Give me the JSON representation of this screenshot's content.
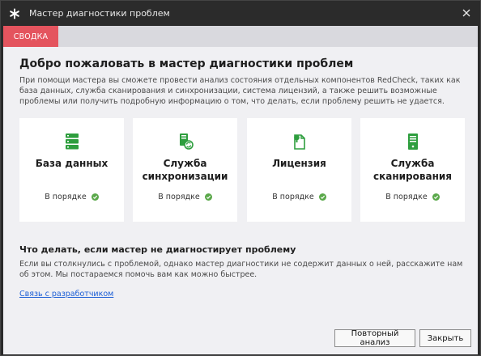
{
  "window": {
    "title": "Мастер диагностики проблем"
  },
  "tabs": [
    {
      "label": "СВОДКА",
      "active": true
    }
  ],
  "main": {
    "welcome_title": "Добро пожаловать в мастер диагностики проблем",
    "intro": "При помощи мастера вы сможете провести анализ состояния отдельных компонентов RedCheck, таких как база данных, служба сканирования и синхронизации, система лицензий, а также решить возможные проблемы или получить подробную информацию о том, что делать, если проблему решить не удается."
  },
  "cards": [
    {
      "title_line1": "База данных",
      "title_line2": "",
      "icon": "database-icon",
      "status": "В порядке"
    },
    {
      "title_line1": "Служба",
      "title_line2": "синхронизации",
      "icon": "sync-service-icon",
      "status": "В порядке"
    },
    {
      "title_line1": "Лицензия",
      "title_line2": "",
      "icon": "license-icon",
      "status": "В порядке"
    },
    {
      "title_line1": "Служба",
      "title_line2": "сканирования",
      "icon": "server-icon",
      "status": "В порядке"
    }
  ],
  "help": {
    "title": "Что делать, если мастер не диагностирует проблему",
    "text": "Если вы столкнулись с проблемой, однако мастер диагностики не содержит данных о ней, расскажите нам об этом. Мы постараемся помочь вам как можно быстрее.",
    "link": "Связь с разработчиком"
  },
  "footer": {
    "reanalyze_label": "Повторный анализ",
    "close_label": "Закрыть"
  },
  "colors": {
    "accent_tab": "#e4545e",
    "icon_green": "#2e9e3e",
    "status_ok": "#5aa84a",
    "link": "#1d5fd6"
  }
}
